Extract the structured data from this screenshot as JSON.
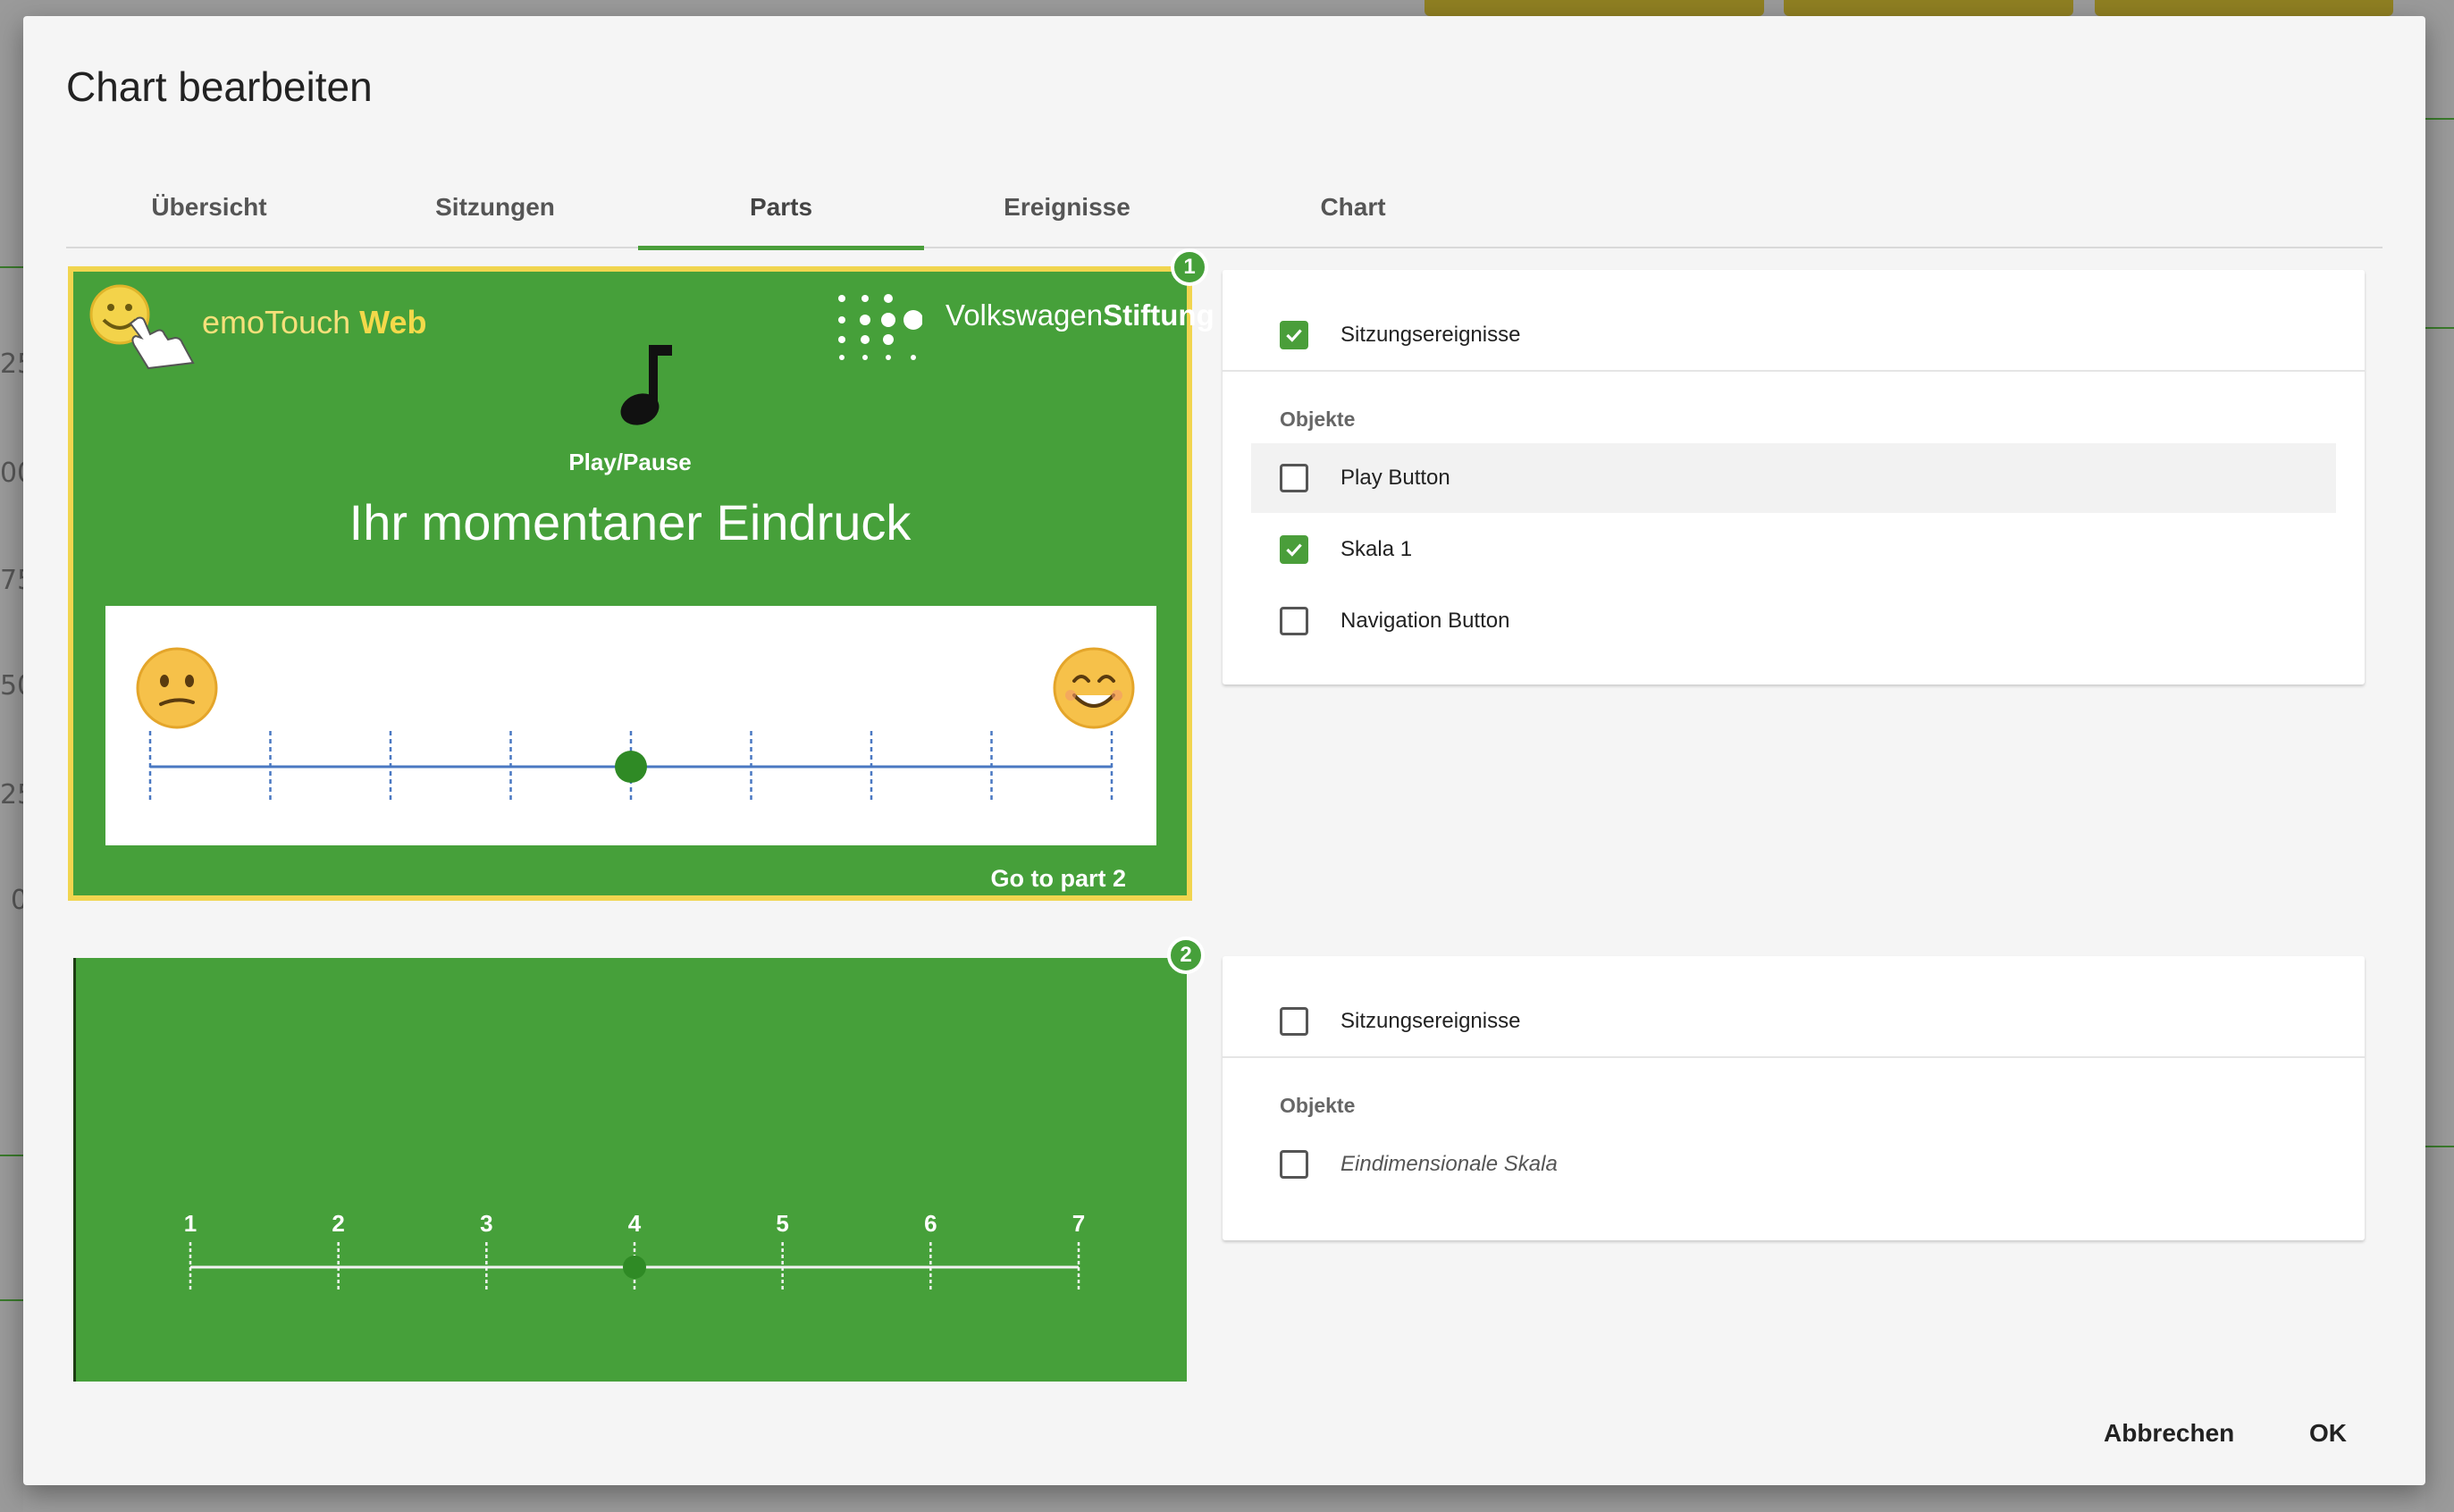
{
  "dialog": {
    "title": "Chart bearbeiten"
  },
  "tabs": [
    {
      "label": "Übersicht",
      "active": false
    },
    {
      "label": "Sitzungen",
      "active": false
    },
    {
      "label": "Parts",
      "active": true
    },
    {
      "label": "Ereignisse",
      "active": false
    },
    {
      "label": "Chart",
      "active": false
    }
  ],
  "parts": [
    {
      "badge": "1",
      "brand_left": "emoTouch",
      "brand_left_bold": "Web",
      "brand_right": "Volkswagen",
      "brand_right_bold": "Stiftung",
      "play_label": "Play/Pause",
      "headline": "Ihr momentaner Eindruck",
      "scale": {
        "ticks": 9,
        "selected_index": 4
      },
      "goto_label": "Go to part 2",
      "card": {
        "session_events_label": "Sitzungsereignisse",
        "session_events_checked": true,
        "objects_label": "Objekte",
        "objects": [
          {
            "label": "Play Button",
            "checked": false
          },
          {
            "label": "Skala 1",
            "checked": true
          },
          {
            "label": "Navigation Button",
            "checked": false
          }
        ]
      }
    },
    {
      "badge": "2",
      "scale": {
        "ticks": [
          "1",
          "2",
          "3",
          "4",
          "5",
          "6",
          "7"
        ],
        "selected_index": 3
      },
      "card": {
        "session_events_label": "Sitzungsereignisse",
        "session_events_checked": false,
        "objects_label": "Objekte",
        "objects": [
          {
            "label": "Eindimensionale Skala",
            "checked": false
          }
        ]
      }
    }
  ],
  "footer": {
    "cancel_label": "Abbrechen",
    "ok_label": "OK"
  },
  "colors": {
    "accent_green": "#4a9e3a",
    "part_green": "#46a03a",
    "highlight_yellow": "#f1d54f"
  },
  "background": {
    "axis_ticks": [
      "25",
      "00",
      "75",
      "50",
      "25",
      "0"
    ]
  }
}
